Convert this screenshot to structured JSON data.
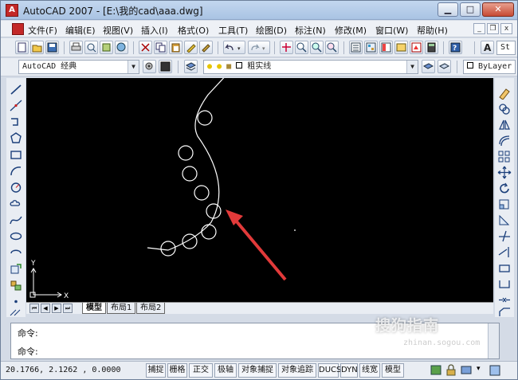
{
  "window": {
    "title": "AutoCAD 2007 - [E:\\我的cad\\aaa.dwg]",
    "app_icon": "autocad-logo-icon",
    "minimize_glyph": "▁",
    "maximize_glyph": "□",
    "close_glyph": "✕"
  },
  "menu": {
    "items": [
      "文件(F)",
      "编辑(E)",
      "视图(V)",
      "插入(I)",
      "格式(O)",
      "工具(T)",
      "绘图(D)",
      "标注(N)",
      "修改(M)",
      "窗口(W)",
      "帮助(H)"
    ],
    "mdi_minimize": "_",
    "mdi_restore": "❐",
    "mdi_close": "x"
  },
  "workspace": {
    "combo_value": "AutoCAD 经典"
  },
  "layer": {
    "combo_value": "粗实线",
    "color_combo": "ByLayer"
  },
  "toolbar_text": {
    "style_label": "St"
  },
  "layout_tabs": {
    "items": [
      "模型",
      "布局1",
      "布局2"
    ],
    "active": "模型"
  },
  "ucs": {
    "x_label": "X",
    "y_label": "Y"
  },
  "command": {
    "line1": "命令:",
    "line2": "命令:"
  },
  "status": {
    "coordinates": "20.1766, 2.1262 , 0.0000",
    "buttons": [
      "捕捉",
      "栅格",
      "正交",
      "极轴",
      "对象捕捉",
      "对象追踪",
      "DUCS",
      "DYN",
      "线宽",
      "模型"
    ]
  },
  "watermark": {
    "text": "搜狗指南",
    "sub": "zhinan.sogou.com"
  },
  "colors": {
    "drawing_bg": "#000000",
    "arrow": "#e23a3a",
    "geometry": "#ffffff"
  }
}
